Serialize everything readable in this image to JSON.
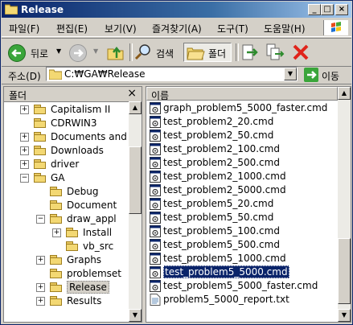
{
  "window": {
    "title": "Release",
    "controls": {
      "minimize": "_",
      "maximize": "□",
      "close": "×"
    }
  },
  "menu": [
    "파일(F)",
    "편집(E)",
    "보기(V)",
    "즐겨찾기(A)",
    "도구(T)",
    "도움말(H)"
  ],
  "toolbar": {
    "back_label": "뒤로",
    "search_label": "검색",
    "folders_label": "폴더"
  },
  "address": {
    "label": "주소(D)",
    "value": "C:₩GA₩Release",
    "go_label": "이동"
  },
  "folder_pane": {
    "title": "폴더",
    "close": "×",
    "items": [
      {
        "label": "Capitalism II",
        "expander": "+"
      },
      {
        "label": "CDRWIN3",
        "expander": ""
      },
      {
        "label": "Documents and S",
        "expander": "+"
      },
      {
        "label": "Downloads",
        "expander": "+"
      },
      {
        "label": "driver",
        "expander": "+"
      },
      {
        "label": "GA",
        "expander": "−"
      },
      {
        "label": "Debug",
        "expander": ""
      },
      {
        "label": "Document",
        "expander": ""
      },
      {
        "label": "draw_appl",
        "expander": "−"
      },
      {
        "label": "Install",
        "expander": "+"
      },
      {
        "label": "vb_src",
        "expander": ""
      },
      {
        "label": "Graphs",
        "expander": "+"
      },
      {
        "label": "problemset",
        "expander": ""
      },
      {
        "label": "Release",
        "expander": "+",
        "selected": true
      },
      {
        "label": "Results",
        "expander": "+"
      }
    ]
  },
  "file_list": {
    "column_name": "이름",
    "files": [
      {
        "name": "graph_problem5_5000_faster.cmd",
        "icon": "cmd-file-icon"
      },
      {
        "name": "test_problem2_20.cmd",
        "icon": "cmd-file-icon"
      },
      {
        "name": "test_problem2_50.cmd",
        "icon": "cmd-file-icon"
      },
      {
        "name": "test_problem2_100.cmd",
        "icon": "cmd-file-icon"
      },
      {
        "name": "test_problem2_500.cmd",
        "icon": "cmd-file-icon"
      },
      {
        "name": "test_problem2_1000.cmd",
        "icon": "cmd-file-icon"
      },
      {
        "name": "test_problem2_5000.cmd",
        "icon": "cmd-file-icon"
      },
      {
        "name": "test_problem5_20.cmd",
        "icon": "cmd-file-icon"
      },
      {
        "name": "test_problem5_50.cmd",
        "icon": "cmd-file-icon"
      },
      {
        "name": "test_problem5_100.cmd",
        "icon": "cmd-file-icon"
      },
      {
        "name": "test_problem5_500.cmd",
        "icon": "cmd-file-icon"
      },
      {
        "name": "test_problem5_1000.cmd",
        "icon": "cmd-file-icon"
      },
      {
        "name": "test_problem5_5000.cmd",
        "icon": "cmd-file-icon",
        "selected": true
      },
      {
        "name": "test_problem5_5000_faster.cmd",
        "icon": "cmd-file-icon"
      },
      {
        "name": "problem5_5000_report.txt",
        "icon": "txt-file-icon"
      }
    ]
  },
  "colors": {
    "titlebar_start": "#0a246a",
    "titlebar_end": "#a6caf0",
    "selection": "#0a246a",
    "chrome": "#d4d0c8"
  }
}
